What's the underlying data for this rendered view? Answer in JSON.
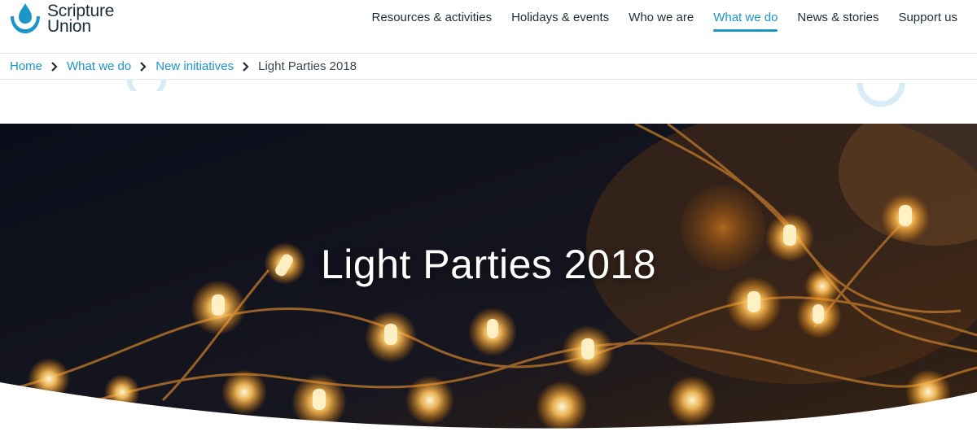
{
  "site": {
    "logo_line1": "Scripture",
    "logo_line2": "Union",
    "brand_color": "#1c95c8"
  },
  "nav": {
    "items": [
      {
        "label": "Resources & activities"
      },
      {
        "label": "Holidays & events"
      },
      {
        "label": "Who we are"
      },
      {
        "label": "What we do"
      },
      {
        "label": "News & stories"
      },
      {
        "label": "Support us"
      }
    ],
    "active": "What we do"
  },
  "breadcrumb": {
    "items": [
      {
        "label": "Home"
      },
      {
        "label": "What we do"
      },
      {
        "label": "New initiatives"
      }
    ],
    "current": "Light Parties 2018",
    "separator_icon": "chevron-right-icon"
  },
  "hero": {
    "title": "Light Parties 2018",
    "image": "fairy-lights-photo"
  }
}
